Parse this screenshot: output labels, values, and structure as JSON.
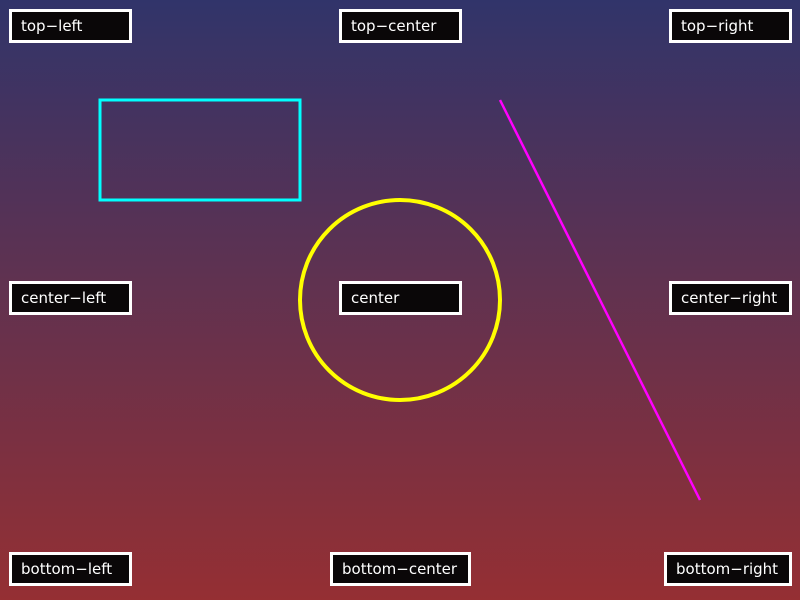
{
  "colors": {
    "gradient_top": "#31346a",
    "gradient_bottom": "#952f33",
    "rectangle_stroke": "#00ffff",
    "circle_stroke": "#ffff00",
    "line_stroke": "#ff00ff",
    "label_background": "#0a0708",
    "label_border": "#ffffff",
    "label_text": "#ffffff"
  },
  "labels": {
    "top_left": "top−left",
    "top_center": "top−center",
    "top_right": "top−right",
    "center_left": "center−left",
    "center": "center",
    "center_right": "center−right",
    "bottom_left": "bottom−left",
    "bottom_center": "bottom−center",
    "bottom_right": "bottom−right"
  },
  "shapes": {
    "rectangle": "cyan-rectangle-outline",
    "circle": "yellow-circle-outline",
    "line": "magenta-diagonal-line"
  }
}
